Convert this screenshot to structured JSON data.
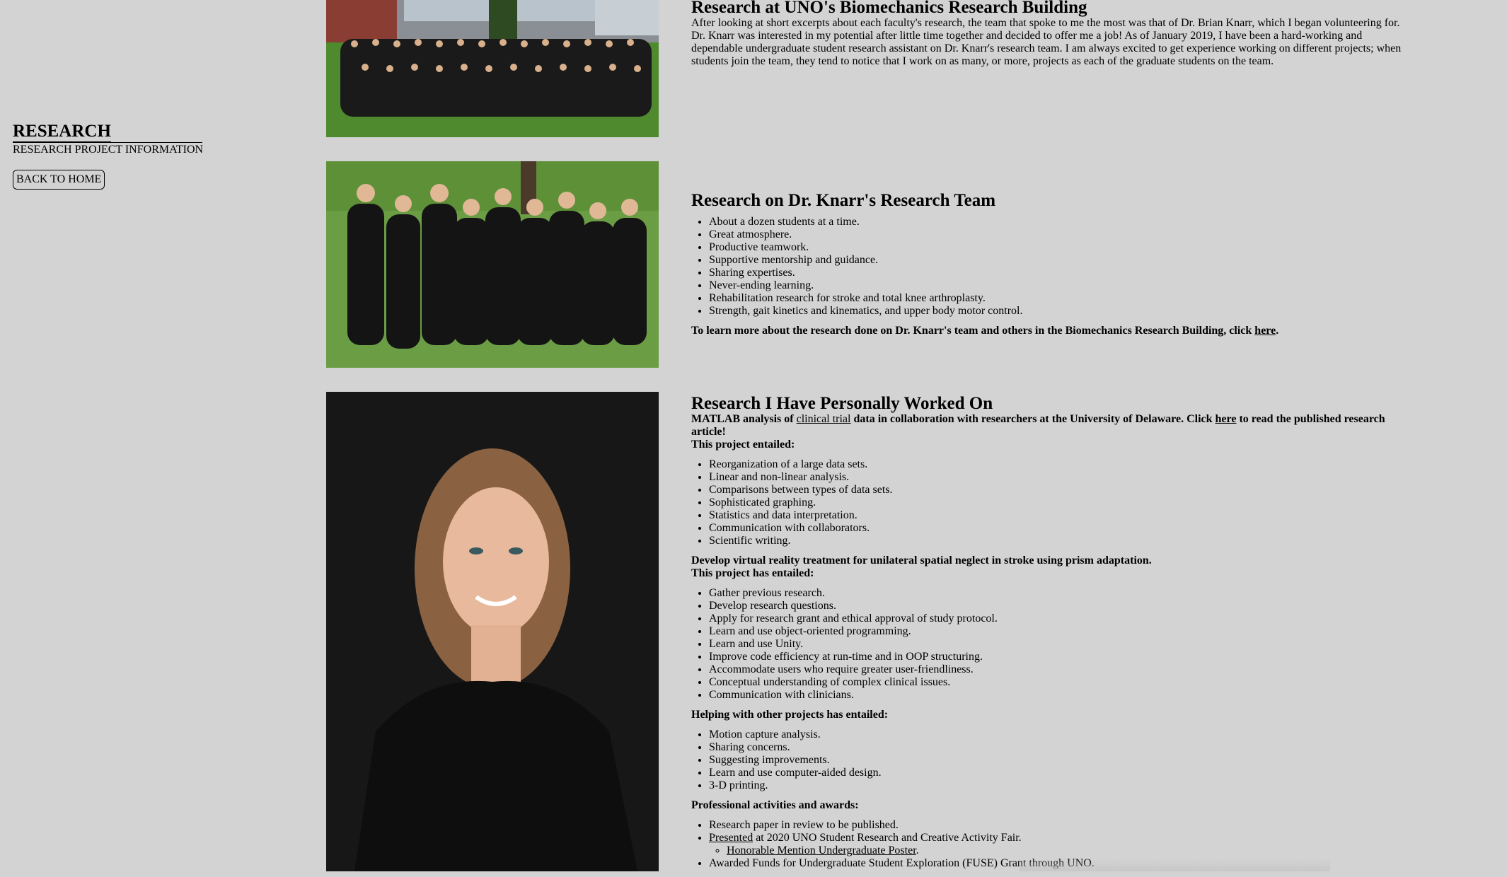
{
  "sidebar": {
    "title": "RESEARCH",
    "subtitle": "RESEARCH PROJECT INFORMATION",
    "back_button": "BACK TO HOME"
  },
  "photos": {
    "photo1": "group-photo-building-icon",
    "photo2": "team-photo-icon",
    "photo3": "portrait-photo-icon"
  },
  "section1": {
    "heading": "Research at UNO's Biomechanics Research Building",
    "body": "After looking at short excerpts about each faculty's research, the team that spoke to me the most was that of Dr. Brian Knarr, which I began volunteering for. Dr. Knarr was interested in my potential after little time together and decided to offer me a job! As of January 2019, I have been a hard-working and dependable undergraduate student research assistant on Dr. Knarr's research team. I am always excited to get experience working on different projects; when students join the team, they tend to notice that I work on as many, or more, projects as each of the graduate students on the team."
  },
  "section2": {
    "heading": "Research on Dr. Knarr's Research Team",
    "items": [
      "About a dozen students at a time.",
      "Great atmosphere.",
      "Productive teamwork.",
      "Supportive mentorship and guidance.",
      "Sharing expertises.",
      "Never-ending learning.",
      "Rehabilitation research for stroke and total knee arthroplasty.",
      "Strength, gait kinetics and kinematics, and upper body motor control."
    ],
    "learn_more_pre": "To learn more about the research done on Dr. Knarr's team and others in the Biomechanics Research Building, click ",
    "learn_more_link": "here",
    "learn_more_post": "."
  },
  "section3": {
    "heading": "Research I Have Personally Worked On",
    "matlab_pre": "MATLAB analysis of ",
    "matlab_term": "clinical trial",
    "matlab_mid": " data in collaboration with researchers at the University of Delaware. Click ",
    "matlab_link": "here",
    "matlab_post": " to read the published research article!",
    "entailed1_label": "This project entailed:",
    "entailed1_items": [
      "Reorganization of a large data sets.",
      "Linear and non-linear analysis.",
      "Comparisons between types of data sets.",
      "Sophisticated graphing.",
      "Statistics and data interpretation.",
      "Communication with collaborators.",
      "Scientific writing."
    ],
    "vr_title": "Develop virtual reality treatment for unilateral spatial neglect in stroke using prism adaptation.",
    "entailed2_label": "This project has entailed:",
    "entailed2_items": [
      "Gather previous research.",
      "Develop research questions.",
      "Apply for research grant and ethical approval of study protocol.",
      "Learn and use object-oriented programming.",
      "Learn and use Unity.",
      "Improve code efficiency at run-time and in OOP structuring.",
      "Accommodate users who require greater user-friendliness.",
      "Conceptual understanding of complex clinical issues.",
      "Communication with clinicians."
    ],
    "other_label": "Helping with other projects has entailed:",
    "other_items": [
      "Motion capture analysis.",
      "Sharing concerns.",
      "Suggesting improvements.",
      "Learn and use computer-aided design.",
      "3-D printing."
    ],
    "prof_label": "Professional activities and awards:",
    "prof_item1": "Research paper in review to be published.",
    "prof_item2_link": "Presented",
    "prof_item2_rest": " at 2020 UNO Student Research and Creative Activity Fair.",
    "prof_item2_sub": "Honorable Mention Undergraduate Poster",
    "prof_item2_sub_post": ".",
    "prof_item3": "Awarded Funds for Undergraduate Student Exploration (FUSE) Grant through UNO."
  }
}
